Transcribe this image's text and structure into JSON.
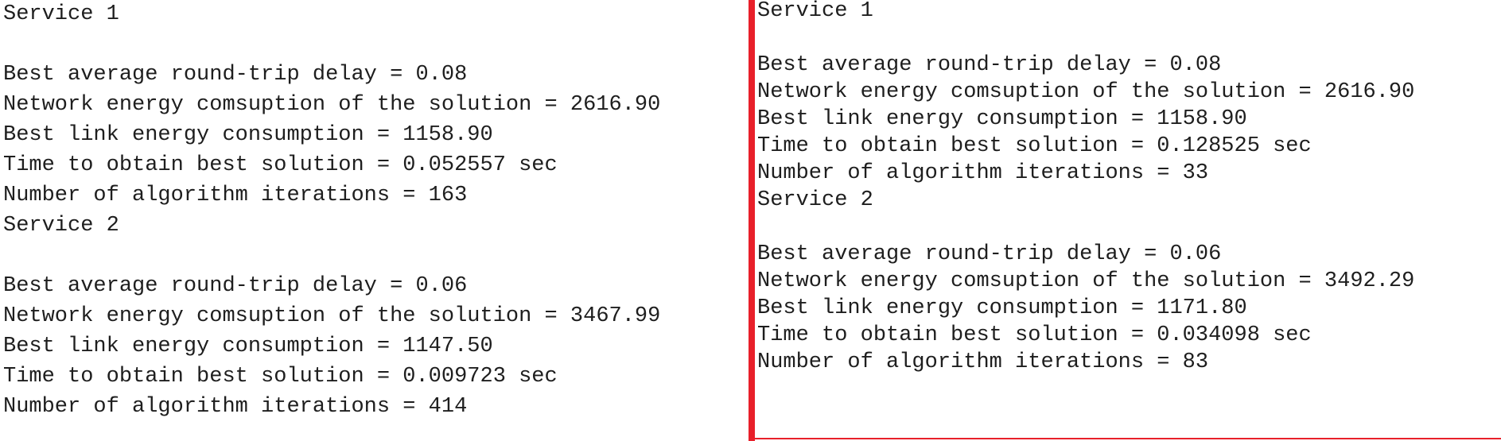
{
  "left_output": {
    "lines": [
      "Service 1",
      "",
      "Best average round-trip delay = 0.08",
      "Network energy comsuption of the solution = 2616.90",
      "Best link energy consumption = 1158.90",
      "Time to obtain best solution = 0.052557 sec",
      "Number of algorithm iterations = 163",
      "Service 2",
      "",
      "Best average round-trip delay = 0.06",
      "Network energy comsuption of the solution = 3467.99",
      "Best link energy consumption = 1147.50",
      "Time to obtain best solution = 0.009723 sec",
      "Number of algorithm iterations = 414"
    ]
  },
  "right_output": {
    "lines": [
      "Service 1",
      "",
      "Best average round-trip delay = 0.08",
      "Network energy comsuption of the solution = 2616.90",
      "Best link energy consumption = 1158.90",
      "Time to obtain best solution = 0.128525 sec",
      "Number of algorithm iterations = 33",
      "Service 2",
      "",
      "Best average round-trip delay = 0.06",
      "Network energy comsuption of the solution = 3492.29",
      "Best link energy consumption = 1171.80",
      "Time to obtain best solution = 0.034098 sec",
      "Number of algorithm iterations = 83"
    ]
  },
  "colors": {
    "divider": "#e8202a",
    "text": "#1e1e1e",
    "background": "#ffffff"
  }
}
